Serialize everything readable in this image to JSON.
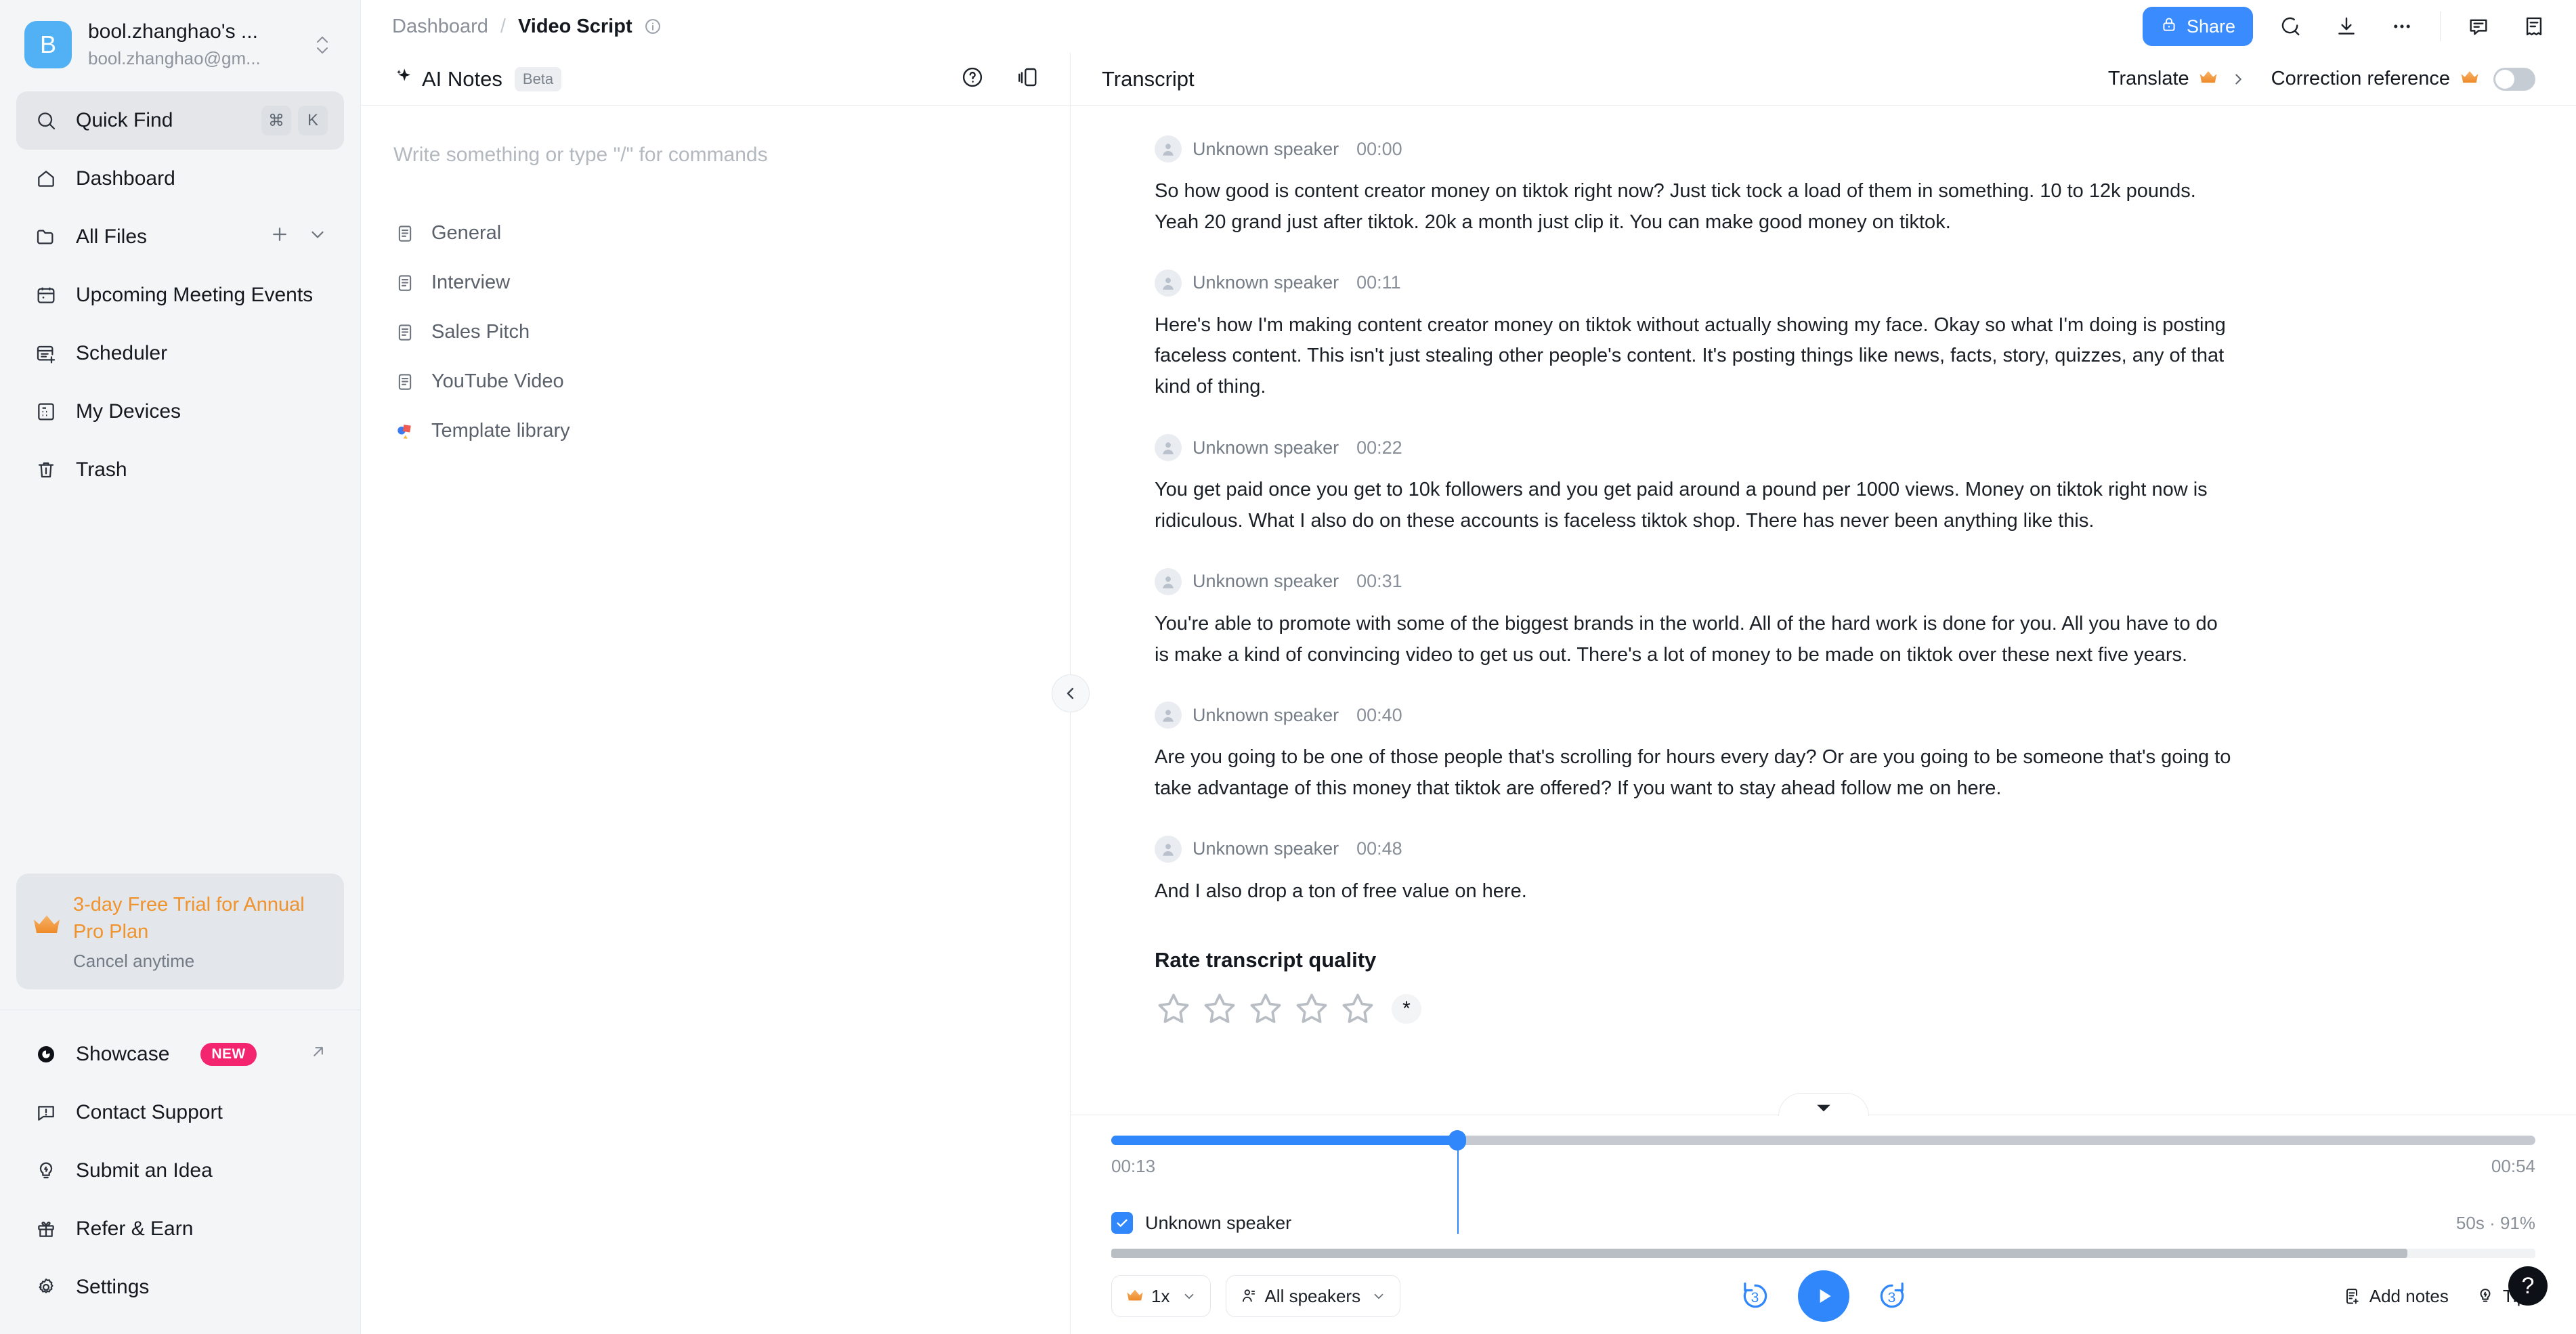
{
  "account": {
    "avatar_letter": "B",
    "name": "bool.zhanghao's ...",
    "email": "bool.zhanghao@gm..."
  },
  "sidebar": {
    "quick_find": {
      "label": "Quick Find",
      "kbd_1": "⌘",
      "kbd_2": "K"
    },
    "items": [
      {
        "label": "Dashboard",
        "icon": "home-icon"
      },
      {
        "label": "All Files",
        "icon": "folder-icon"
      },
      {
        "label": "Upcoming Meeting Events",
        "icon": "calendar-icon"
      },
      {
        "label": "Scheduler",
        "icon": "scheduler-icon"
      },
      {
        "label": "My Devices",
        "icon": "devices-icon"
      },
      {
        "label": "Trash",
        "icon": "trash-icon"
      }
    ],
    "promo": {
      "title": "3-day Free Trial for Annual Pro Plan",
      "subtitle": "Cancel anytime",
      "icon": "crown-icon",
      "accent": "#f0932d"
    },
    "footer_items": [
      {
        "label": "Showcase",
        "icon": "showcase-icon",
        "badge": "NEW",
        "badge_color": "#f4256f",
        "external": true
      },
      {
        "label": "Contact Support",
        "icon": "support-icon"
      },
      {
        "label": "Submit an Idea",
        "icon": "idea-icon"
      },
      {
        "label": "Refer & Earn",
        "icon": "gift-icon"
      },
      {
        "label": "Settings",
        "icon": "gear-icon"
      }
    ]
  },
  "topbar": {
    "breadcrumb_root": "Dashboard",
    "breadcrumb_sep": "/",
    "breadcrumb_current": "Video Script",
    "share_label": "Share",
    "actions": [
      "search-icon",
      "download-icon",
      "more-icon",
      "comment-icon",
      "summary-icon"
    ]
  },
  "notes": {
    "title": "AI Notes",
    "badge": "Beta",
    "placeholder": "Write something or type \"/\" for commands",
    "templates": [
      {
        "label": "General",
        "icon": "doc-icon"
      },
      {
        "label": "Interview",
        "icon": "doc-icon"
      },
      {
        "label": "Sales Pitch",
        "icon": "doc-icon"
      },
      {
        "label": "YouTube Video",
        "icon": "doc-icon"
      },
      {
        "label": "Template library",
        "icon": "template-library-icon"
      }
    ]
  },
  "transcript": {
    "title": "Transcript",
    "translate_label": "Translate",
    "correction_label": "Correction reference",
    "correction_enabled": false,
    "segments": [
      {
        "speaker": "Unknown speaker",
        "time": "00:00",
        "text": "So how good is content creator money on tiktok right now? Just tick tock a load of them in something. 10 to 12k pounds. Yeah 20 grand just after tiktok. 20k a month just clip it. You can make good money on tiktok."
      },
      {
        "speaker": "Unknown speaker",
        "time": "00:11",
        "text": "Here's how I'm making content creator money on tiktok without actually showing my face. Okay so what I'm doing is posting faceless content. This isn't just stealing other people's content. It's posting things like news, facts, story, quizzes, any of that kind of thing."
      },
      {
        "speaker": "Unknown speaker",
        "time": "00:22",
        "text": "You get paid once you get to 10k followers and you get paid around a pound per 1000 views. Money on tiktok right now is ridiculous. What I also do on these accounts is faceless tiktok shop. There has never been anything like this."
      },
      {
        "speaker": "Unknown speaker",
        "time": "00:31",
        "text": "You're able to promote with some of the biggest brands in the world. All of the hard work is done for you. All you have to do is make a kind of convincing video to get us out. There's a lot of money to be made on tiktok over these next five years."
      },
      {
        "speaker": "Unknown speaker",
        "time": "00:40",
        "text": "Are you going to be one of those people that's scrolling for hours every day? Or are you going to be someone that's going to take advantage of this money that tiktok are offered? If you want to stay ahead follow me on here."
      },
      {
        "speaker": "Unknown speaker",
        "time": "00:48",
        "text": "And I also drop a ton of free value on here."
      }
    ],
    "rating": {
      "title": "Rate transcript quality",
      "stars_total": 5,
      "stars_filled": 0,
      "required_mark": "*"
    }
  },
  "player": {
    "current_time": "00:13",
    "total_time": "00:54",
    "progress_percent": 24,
    "speaker_checkbox_label": "Unknown speaker",
    "speaker_checked": true,
    "speaker_meta": "50s · 91%",
    "speed_label": "1x",
    "speakers_label": "All speakers",
    "skip_back_label": "3",
    "skip_forward_label": "3",
    "add_notes_label": "Add notes",
    "tips_label": "Tips",
    "accent": "#2f87fb"
  },
  "help": {
    "glyph": "?"
  }
}
